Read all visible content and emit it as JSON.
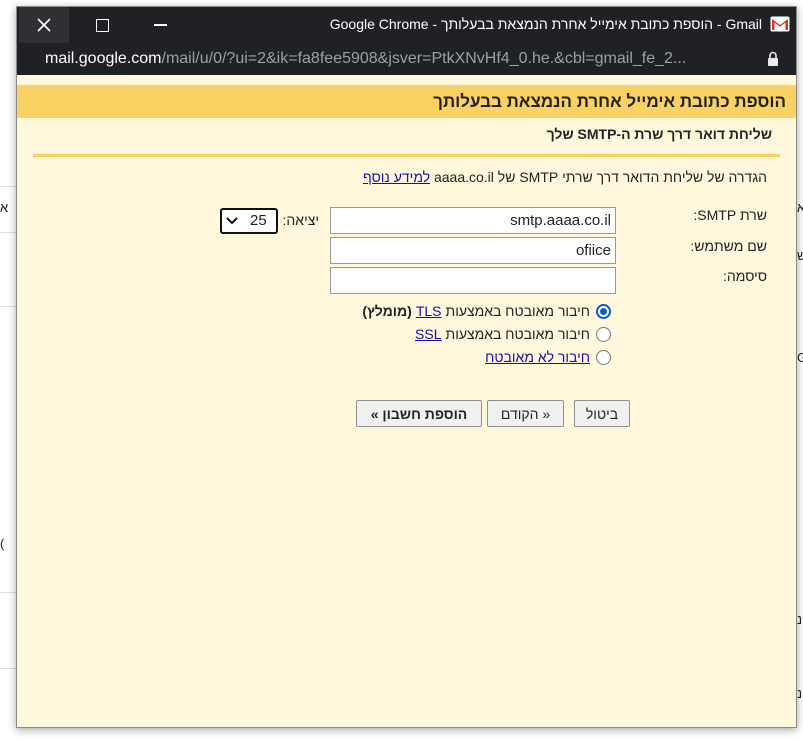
{
  "window": {
    "title": "Gmail - הוספת כתובת אימייל אחרת הנמצאת בבעלותך - Google Chrome",
    "url_host": "mail.google.com",
    "url_path": "/mail/u/0/?ui=2&ik=fa8fee5908&jsver=PtkXNvHf4_0.he.&cbl=gmail_fe_2..."
  },
  "dialog": {
    "header": "הוספת כתובת אימייל אחרת הנמצאת בבעלותך",
    "subtitle": "שליחת דואר דרך שרת ה-SMTP שלך",
    "description": "הגדרה של שליחת הדואר דרך שרתי SMTP של aaaa.co.il",
    "learn_more": "למידע נוסף"
  },
  "form": {
    "smtp_label": "שרת SMTP:",
    "smtp_value": "smtp.aaaa.co.il",
    "port_label": "יציאה:",
    "port_value": "25",
    "username_label": "שם משתמש:",
    "username_value": "ofiice",
    "password_label": "סיסמה:",
    "password_value": ""
  },
  "security": {
    "tls_prefix": "חיבור מאובטח באמצעות",
    "tls_link": "TLS",
    "tls_note": "(מומלץ)",
    "ssl_prefix": "חיבור מאובטח באמצעות",
    "ssl_link": "SSL",
    "unsecured_link": "חיבור לא מאובטח",
    "selected": "TLS"
  },
  "buttons": {
    "cancel": "ביטול",
    "back": "« הקודם",
    "add_account": "הוספת חשבון »"
  },
  "background": {
    "left_fragment": "א",
    "right_fragment_1": "א",
    "right_fragment_2": "ש",
    "right_fragment_3": "G",
    "left_fragment_2": "(",
    "right_fragment_4": "נ",
    "right_fragment_5": "נ"
  },
  "colors": {
    "titlebar": "#202124",
    "header_band": "#fad163",
    "dialog_bg": "#fff8dc",
    "link": "#1a0dab",
    "gmail_red": "#d93025"
  },
  "icons": [
    "close-icon",
    "maximize-icon",
    "minimize-icon",
    "gmail-icon",
    "lock-icon",
    "chevron-down-icon"
  ]
}
